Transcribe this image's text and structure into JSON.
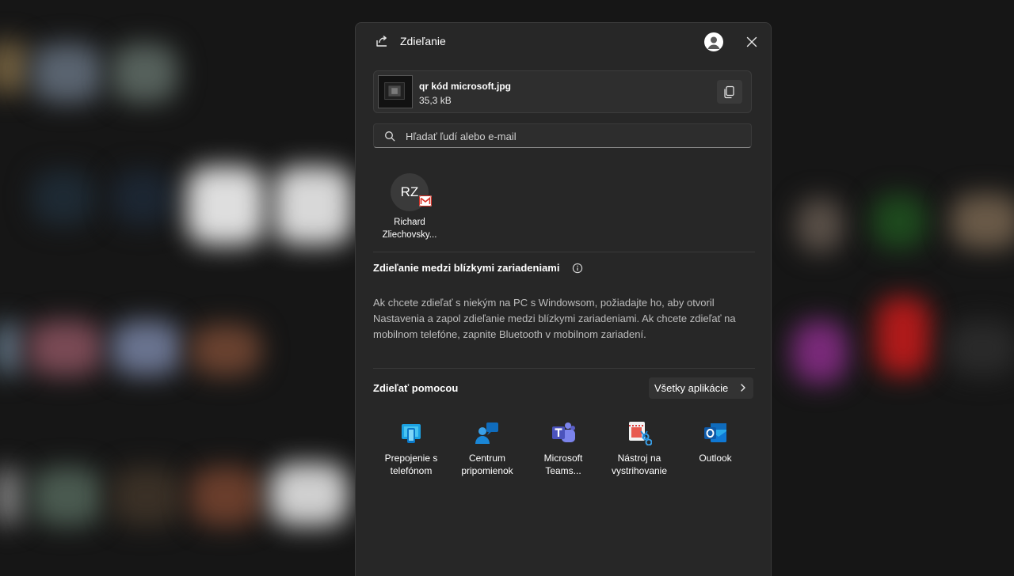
{
  "share": {
    "title": "Zdieľanie",
    "file": {
      "name": "qr kód microsoft.jpg",
      "size": "35,3 kB"
    },
    "search": {
      "placeholder": "Hľadať ľudí alebo e-mail"
    },
    "contacts": [
      {
        "initials": "RZ",
        "name_line1": "Richard",
        "name_line2": "Zliechovsky..."
      }
    ],
    "nearby": {
      "heading": "Zdieľanie medzi blízkymi zariadeniami",
      "text": "Ak chcete zdieľať s niekým na PC s Windowsom, požiadajte ho, aby otvoril Nastavenia a zapol zdieľanie medzi blízkymi zariadeniami. Ak chcete zdieľať na mobilnom telefóne, zapnite Bluetooth v mobilnom zariadení."
    },
    "share_with": {
      "heading": "Zdieľať pomocou",
      "all_apps_label": "Všetky aplikácie"
    },
    "apps": [
      {
        "line1": "Prepojenie s",
        "line2": "telefónom",
        "icon": "phone-link-icon"
      },
      {
        "line1": "Centrum",
        "line2": "pripomienok",
        "icon": "feedback-hub-icon"
      },
      {
        "line1": "Microsoft",
        "line2": "Teams...",
        "icon": "teams-icon"
      },
      {
        "line1": "Nástroj na",
        "line2": "vystrihovanie",
        "icon": "snipping-tool-icon"
      },
      {
        "line1": "Outlook",
        "line2": "",
        "icon": "outlook-icon"
      }
    ]
  },
  "icons": {
    "title": "share-icon",
    "profile": "profile-icon",
    "close": "close-icon",
    "copy": "copy-icon",
    "search": "search-icon",
    "info": "info-icon",
    "chevron": "chevron-right-icon",
    "mail_badge": "gmail-icon"
  },
  "colors": {
    "panel_background": "#272727",
    "card_background": "#2e2e2e",
    "muted_text": "#bdbdbd",
    "phone_link_blue": "#1ba1e2",
    "teams_purple": "#5b5fc7",
    "outlook_blue": "#0f6cbd",
    "gmail_red": "#d93025"
  }
}
